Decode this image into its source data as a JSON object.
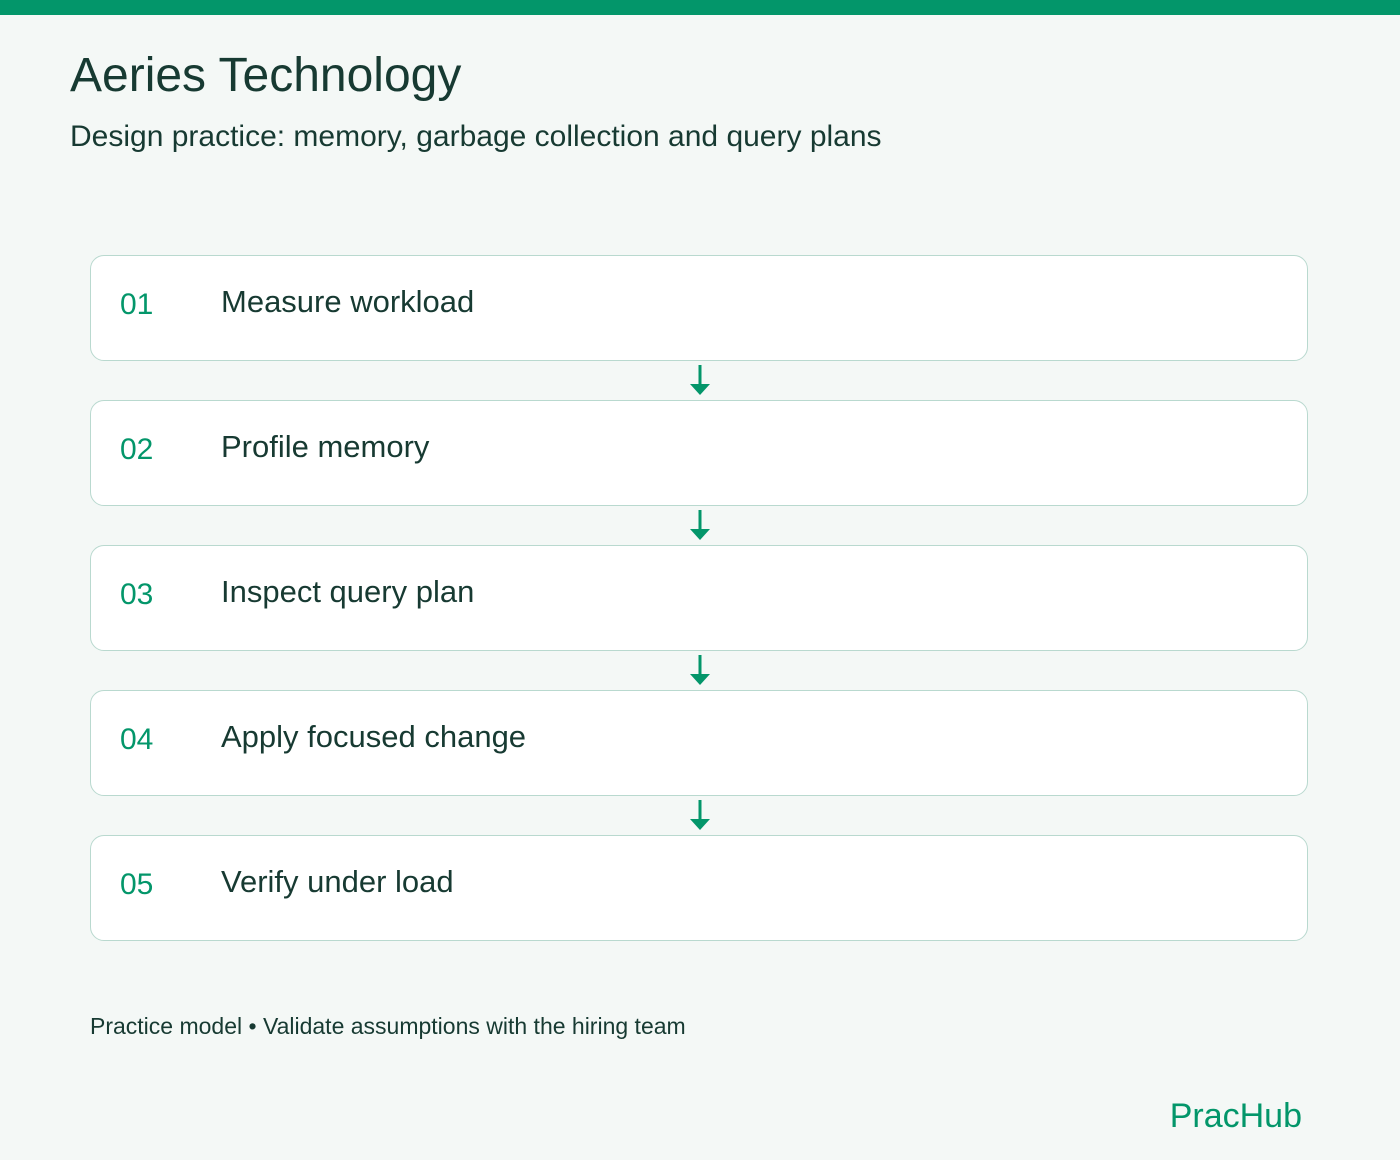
{
  "header": {
    "title": "Aeries Technology",
    "subtitle": "Design practice: memory, garbage collection and query plans"
  },
  "steps": [
    {
      "number": "01",
      "label": "Measure workload"
    },
    {
      "number": "02",
      "label": "Profile memory"
    },
    {
      "number": "03",
      "label": "Inspect query plan"
    },
    {
      "number": "04",
      "label": "Apply focused change"
    },
    {
      "number": "05",
      "label": "Verify under load"
    }
  ],
  "footer": {
    "note": "Practice model • Validate assumptions with the hiring team",
    "brand": "PracHub"
  },
  "colors": {
    "accent": "#03966a",
    "text": "#173a32",
    "card_border": "#b9d9cf",
    "background": "#f4f8f6"
  },
  "icons": {
    "connector": "arrow-down-icon"
  }
}
